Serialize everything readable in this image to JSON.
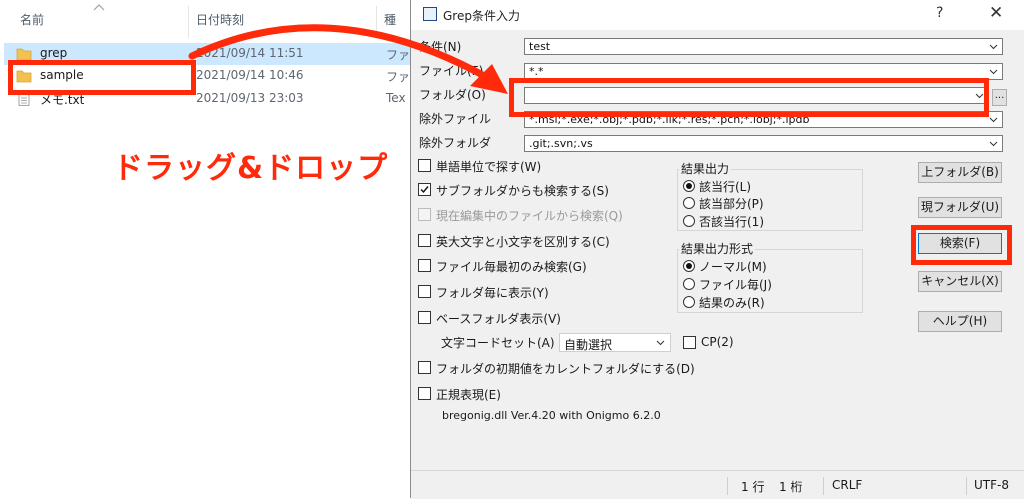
{
  "explorer": {
    "columns": {
      "name": "名前",
      "date": "日付時刻",
      "type": "種"
    },
    "files": [
      {
        "name": "grep",
        "date": "2021/09/14 11:51",
        "type": "ファ",
        "kind": "folder-icon"
      },
      {
        "name": "sample",
        "date": "2021/09/14 10:46",
        "type": "ファ",
        "kind": "folder-icon"
      },
      {
        "name": "メモ.txt",
        "date": "2021/09/13 23:03",
        "type": "Tex",
        "kind": "text-file-icon"
      }
    ]
  },
  "dialog": {
    "title": "Grep条件入力",
    "help_glyph": "?",
    "close_glyph": "✕",
    "fields": {
      "condition": {
        "label": "条件(N)",
        "value": "test"
      },
      "file": {
        "label": "ファイル(F)",
        "value": "*.*"
      },
      "folder": {
        "label": "フォルダ(O)",
        "value": ""
      },
      "exclude_file": {
        "label": "除外ファイル",
        "value": "*.msi;*.exe;*.obj;*.pdb;*.ilk;*.res;*.pch;*.iobj;*.ipdb"
      },
      "exclude_folder": {
        "label": "除外フォルダ",
        "value": ".git;.svn;.vs"
      }
    },
    "browse_label": "...",
    "checkboxes": [
      {
        "label": "単語単位で探す(W)",
        "checked": false,
        "disabled": false
      },
      {
        "label": "サブフォルダからも検索する(S)",
        "checked": true,
        "disabled": false
      },
      {
        "label": "現在編集中のファイルから検索(Q)",
        "checked": false,
        "disabled": true
      },
      {
        "label": "英大文字と小文字を区別する(C)",
        "checked": false,
        "disabled": false
      },
      {
        "label": "ファイル毎最初のみ検索(G)",
        "checked": false,
        "disabled": false
      },
      {
        "label": "フォルダ毎に表示(Y)",
        "checked": false,
        "disabled": false
      },
      {
        "label": "ベースフォルダ表示(V)",
        "checked": false,
        "disabled": false
      }
    ],
    "encoding": {
      "label": "文字コードセット(A)",
      "value": "自動選択",
      "cp_label": "CP(2)"
    },
    "checkboxes_lower": [
      {
        "label": "フォルダの初期値をカレントフォルダにする(D)",
        "checked": false
      },
      {
        "label": "正規表現(E)",
        "checked": false
      }
    ],
    "result_output": {
      "title": "結果出力",
      "options": [
        {
          "label": "該当行(L)",
          "selected": true
        },
        {
          "label": "該当部分(P)",
          "selected": false
        },
        {
          "label": "否該当行(1)",
          "selected": false
        }
      ]
    },
    "result_format": {
      "title": "結果出力形式",
      "options": [
        {
          "label": "ノーマル(M)",
          "selected": true
        },
        {
          "label": "ファイル毎(J)",
          "selected": false
        },
        {
          "label": "結果のみ(R)",
          "selected": false
        }
      ]
    },
    "buttons": {
      "parent_folder": "上フォルダ(B)",
      "current_folder": "現フォルダ(U)",
      "search": "検索(F)",
      "cancel": "キャンセル(X)",
      "help": "ヘルプ(H)"
    },
    "version_text": "bregonig.dll Ver.4.20 with Onigmo 6.2.0",
    "status": {
      "line": "1 行",
      "col": "1 桁",
      "eol": "CRLF",
      "encoding": "UTF-8"
    }
  },
  "annotation": {
    "text": "ドラッグ&ドロップ",
    "color": "#ff2a0a"
  },
  "colors": {
    "selection": "#cce8ff",
    "dialog_bg": "#f0f0f0",
    "accent": "#0078d7"
  }
}
